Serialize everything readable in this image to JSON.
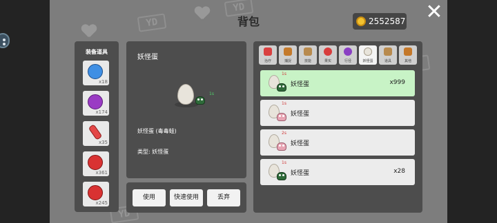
{
  "window": {
    "title": "背包",
    "close_label": "✕"
  },
  "currency": {
    "icon": "coin-icon",
    "value": "2552587"
  },
  "equipment": {
    "title": "装备道具",
    "items": [
      {
        "name": "blue-candy",
        "count": "x18",
        "color": "#3f8fe4"
      },
      {
        "name": "purple-candy",
        "count": "x174",
        "color": "#9a3bc4"
      },
      {
        "name": "red-potion",
        "count": "x35",
        "color": "#e44747"
      },
      {
        "name": "red-berry",
        "count": "x361",
        "color": "#d93232"
      },
      {
        "name": "red-berry-2",
        "count": "x245",
        "color": "#d93232"
      }
    ]
  },
  "detail": {
    "name": "妖怪蛋",
    "tag": "1s",
    "description": "妖怪蛋 (毒毒蛙)",
    "type": "类型: 妖怪蛋"
  },
  "actions": {
    "use": "使用",
    "quick_use": "快速使用",
    "discard": "丢弃"
  },
  "tabs": [
    {
      "label": "治疗",
      "icon": "red-cross-icon",
      "color": "#d94040"
    },
    {
      "label": "捕捉",
      "icon": "bag-icon",
      "color": "#c47a2c"
    },
    {
      "label": "技能",
      "icon": "scroll-icon",
      "color": "#b88a4e"
    },
    {
      "label": "果实",
      "icon": "fruit-icon",
      "color": "#d83d3d"
    },
    {
      "label": "行径",
      "icon": "grape-icon",
      "color": "#8a3fc3"
    },
    {
      "label": "妖怪蛋",
      "icon": "egg-icon",
      "color": "#e8e4db",
      "active": true
    },
    {
      "label": "道具",
      "icon": "box-icon",
      "color": "#b88a4e"
    },
    {
      "label": "其他",
      "icon": "chest-icon",
      "color": "#c4782a"
    }
  ],
  "inventory": [
    {
      "time": "1s",
      "name": "妖怪蛋",
      "count": "x999",
      "monster": "green-frog",
      "selected": true
    },
    {
      "time": "1s",
      "name": "妖怪蛋",
      "count": "",
      "monster": "pink-creature"
    },
    {
      "time": "2s",
      "name": "妖怪蛋",
      "count": "",
      "monster": "pink-creature"
    },
    {
      "time": "1s",
      "name": "妖怪蛋",
      "count": "x28",
      "monster": "green-frog"
    }
  ]
}
